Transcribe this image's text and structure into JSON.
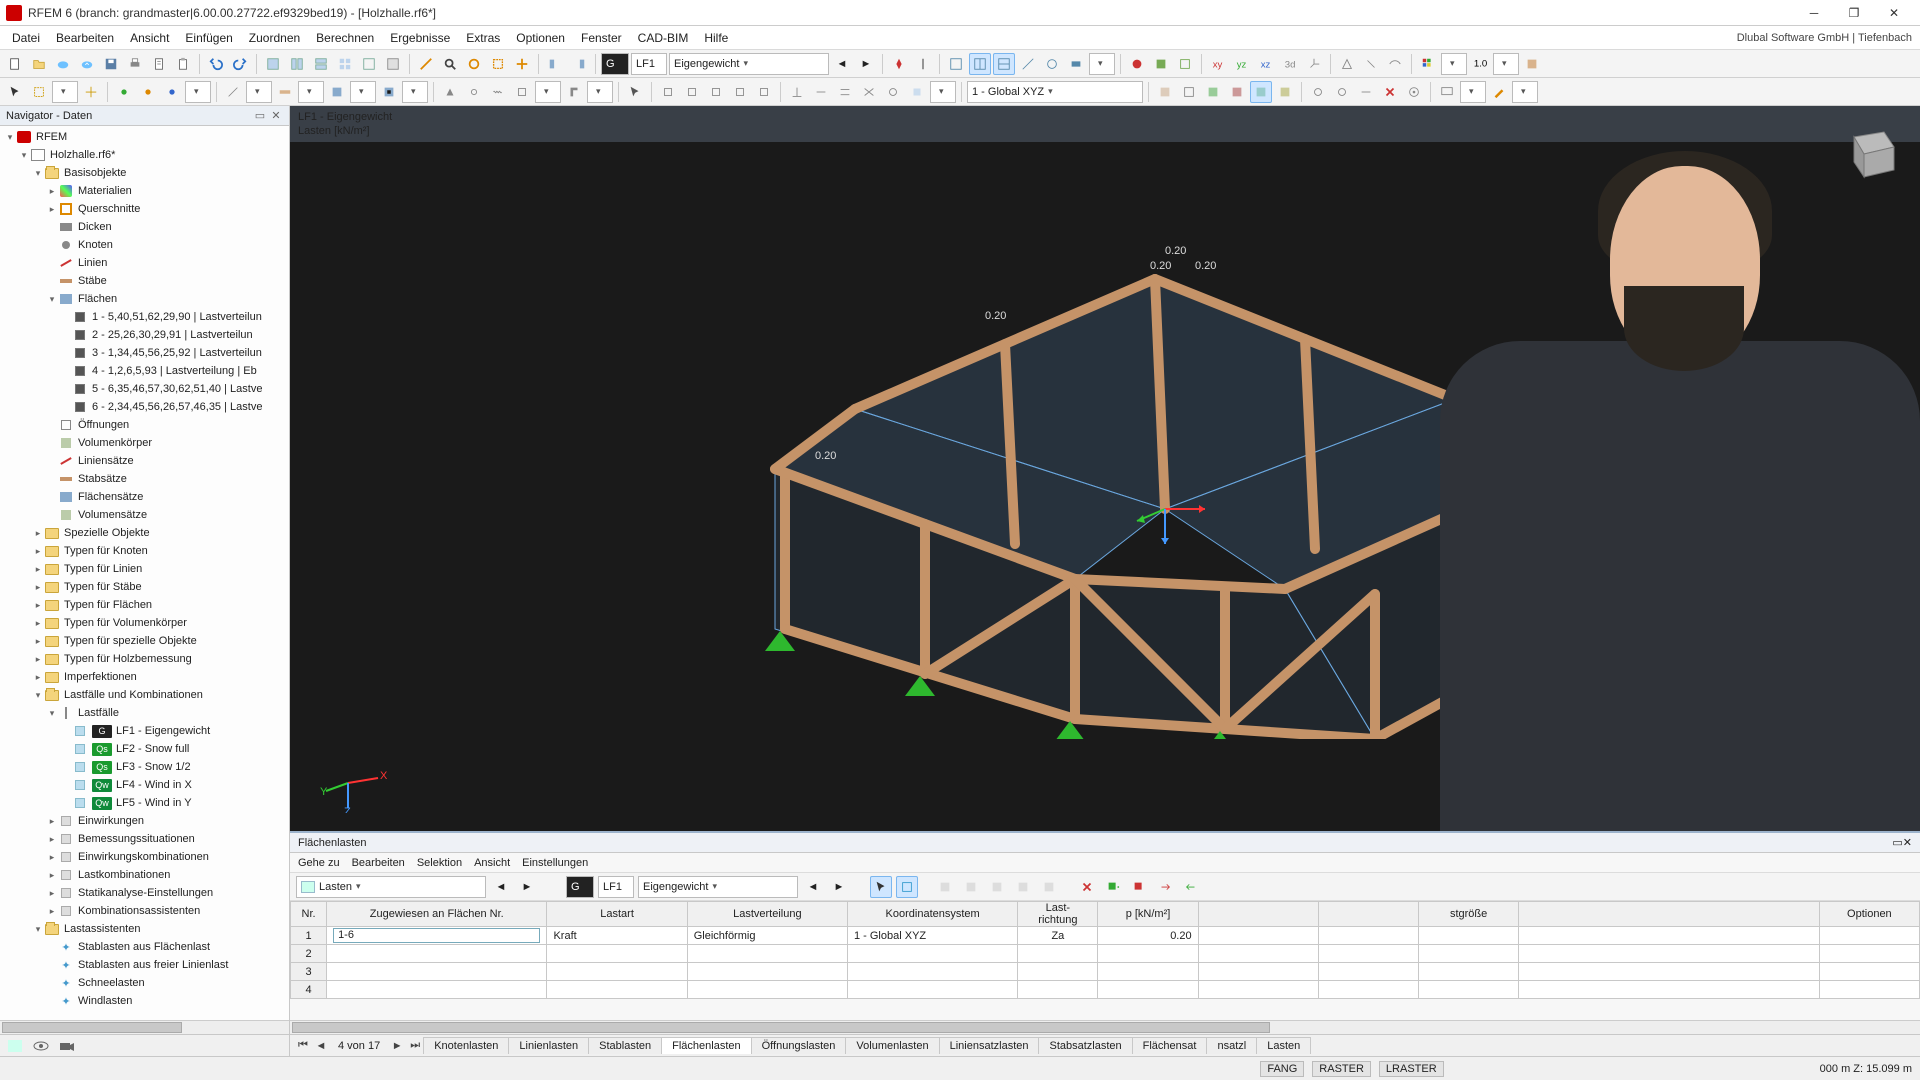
{
  "app": {
    "title": "RFEM 6 (branch: grandmaster|6.00.00.27722.ef9329bed19) - [Holzhalle.rf6*]",
    "brand": "Dlubal Software GmbH | Tiefenbach"
  },
  "menus": [
    "Datei",
    "Bearbeiten",
    "Ansicht",
    "Einfügen",
    "Zuordnen",
    "Berechnen",
    "Ergebnisse",
    "Extras",
    "Optionen",
    "Fenster",
    "CAD-BIM",
    "Hilfe"
  ],
  "toolbar1": {
    "lf_badge": "G",
    "lf_code": "LF1",
    "lf_name": "Eigengewicht"
  },
  "toolbar2": {
    "coord_sys": "1 - Global XYZ"
  },
  "navigator": {
    "title": "Navigator - Daten",
    "root": "RFEM",
    "model": "Holzhalle.rf6*",
    "basis": "Basisobjekte",
    "items_basis": [
      "Materialien",
      "Querschnitte",
      "Dicken",
      "Knoten",
      "Linien",
      "Stäbe"
    ],
    "flaechen": "Flächen",
    "flaechen_items": [
      "1 - 5,40,51,62,29,90 | Lastverteilun",
      "2 - 25,26,30,29,91 | Lastverteilun",
      "3 - 1,34,45,56,25,92 | Lastverteilun",
      "4 - 1,2,6,5,93 | Lastverteilung | Eb",
      "5 - 6,35,46,57,30,62,51,40 | Lastve",
      "6 - 2,34,45,56,26,57,46,35 | Lastve"
    ],
    "after_flaechen": [
      "Öffnungen",
      "Volumenkörper",
      "Liniensätze",
      "Stabsätze",
      "Flächensätze",
      "Volumensätze"
    ],
    "groups": [
      "Spezielle Objekte",
      "Typen für Knoten",
      "Typen für Linien",
      "Typen für Stäbe",
      "Typen für Flächen",
      "Typen für Volumenkörper",
      "Typen für spezielle Objekte",
      "Typen für Holzbemessung",
      "Imperfektionen"
    ],
    "lf_group": "Lastfälle und Kombinationen",
    "lf_sub": "Lastfälle",
    "load_cases": [
      {
        "badge": "G",
        "color": "#222",
        "label": "LF1 - Eigengewicht"
      },
      {
        "badge": "Qs",
        "color": "#1a9a2e",
        "label": "LF2 - Snow full"
      },
      {
        "badge": "Qs",
        "color": "#1a9a2e",
        "label": "LF3 - Snow 1/2"
      },
      {
        "badge": "Qw",
        "color": "#0f8a3a",
        "label": "LF4 - Wind in X"
      },
      {
        "badge": "Qw",
        "color": "#0f8a3a",
        "label": "LF5 - Wind in Y"
      }
    ],
    "lf_rest": [
      "Einwirkungen",
      "Bemessungssituationen",
      "Einwirkungskombinationen",
      "Lastkombinationen",
      "Statikanalyse-Einstellungen",
      "Kombinationsassistenten"
    ],
    "assist_group": "Lastassistenten",
    "assist_items": [
      "Stablasten aus Flächenlast",
      "Stablasten aus freier Linienlast",
      "Schneelasten",
      "Windlasten"
    ]
  },
  "viewport": {
    "line1": "LF1 - Eigengewicht",
    "line2": "Lasten [kN/m²]",
    "labels": {
      "l1": "0.20",
      "l2": "0.20",
      "l3": "0.20",
      "l4": "0.20",
      "l5": "0.20",
      "l6": "0.20"
    }
  },
  "table_panel": {
    "title": "Flächenlasten",
    "menus": [
      "Gehe zu",
      "Bearbeiten",
      "Selektion",
      "Ansicht",
      "Einstellungen"
    ],
    "combo_label": "Lasten",
    "lf_badge": "G",
    "lf_code": "LF1",
    "lf_name": "Eigengewicht",
    "columns": [
      "Nr.",
      "Zugewiesen an Flächen Nr.",
      "Lastart",
      "Lastverteilung",
      "Koordinatensystem",
      "Last-\nrichtung",
      "p [kN/m²]",
      "",
      "",
      "stgröße",
      "",
      "Optionen"
    ],
    "rows": [
      {
        "nr": "1",
        "assigned": "1-6",
        "type": "Kraft",
        "dist": "Gleichförmig",
        "cs": "1 - Global XYZ",
        "dir": "Za",
        "p": "0.20"
      },
      {
        "nr": "2"
      },
      {
        "nr": "3"
      },
      {
        "nr": "4"
      }
    ],
    "page_info": "4 von 17",
    "tabs": [
      "Knotenlasten",
      "Linienlasten",
      "Stablasten",
      "Flächenlasten",
      "Öffnungslasten",
      "Volumenlasten",
      "Liniensatzlasten",
      "Stabsatzlasten",
      "Flächensat",
      "nsatzl",
      "Lasten"
    ],
    "active_tab": 3
  },
  "status": {
    "chips": [
      "FANG",
      "RASTER",
      "LRASTER"
    ],
    "coords": "000 m     Z: 15.099 m"
  }
}
